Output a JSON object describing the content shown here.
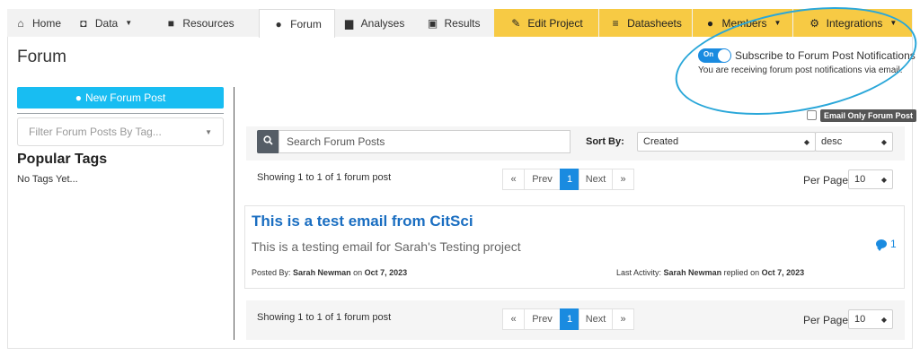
{
  "tabs": [
    {
      "label": "Home",
      "icon": "home-icon",
      "dropdown": false
    },
    {
      "label": "Data",
      "icon": "binoculars-icon",
      "dropdown": true
    },
    {
      "label": "Resources",
      "icon": "file-icon",
      "dropdown": false
    },
    {
      "label": "Forum",
      "icon": "comments-icon",
      "dropdown": false,
      "active": true
    },
    {
      "label": "Analyses",
      "icon": "chart-icon",
      "dropdown": false
    },
    {
      "label": "Results",
      "icon": "image-icon",
      "dropdown": false
    },
    {
      "label": "Edit Project",
      "icon": "pencil-icon",
      "dropdown": false
    },
    {
      "label": "Datasheets",
      "icon": "list-icon",
      "dropdown": false
    },
    {
      "label": "Members",
      "icon": "users-icon",
      "dropdown": true
    },
    {
      "label": "Integrations",
      "icon": "cogs-icon",
      "dropdown": true
    }
  ],
  "page": {
    "title": "Forum"
  },
  "subscribe": {
    "toggle_label": "On",
    "label": "Subscribe to Forum Post Notifications",
    "note": "You are receiving forum post notifications via email."
  },
  "sidebar": {
    "new_post_label": "New Forum Post",
    "filter_placeholder": "Filter Forum Posts By Tag...",
    "popular_tags_heading": "Popular Tags",
    "no_tags_text": "No Tags Yet..."
  },
  "email_only_label": "Email Only Forum Post",
  "search": {
    "placeholder": "Search Forum Posts"
  },
  "sort": {
    "label": "Sort By:",
    "field": "Created",
    "direction": "desc"
  },
  "pagination": {
    "showing": "Showing 1 to 1 of 1 forum post",
    "first": "«",
    "prev": "Prev",
    "current": "1",
    "next": "Next",
    "last": "»",
    "per_page_label": "Per Page",
    "per_page_value": "10"
  },
  "post": {
    "title": "This is a test email from CitSci",
    "description": "This is a testing email for Sarah's Testing project",
    "comment_count": "1",
    "posted_by_label": "Posted By:",
    "posted_by_name": "Sarah Newman",
    "posted_on_label": "on",
    "posted_date": "Oct 7, 2023",
    "last_activity_label": "Last Activity:",
    "last_activity_name": "Sarah Newman",
    "replied_on_label": "replied on",
    "last_activity_date": "Oct 7, 2023"
  },
  "colors": {
    "accent_blue": "#1a8be0",
    "new_post_button": "#18bdf2",
    "admin_tab_yellow": "#f7ca44",
    "annotation_circle": "#2aa7d9",
    "post_title": "#1a6ec1"
  }
}
